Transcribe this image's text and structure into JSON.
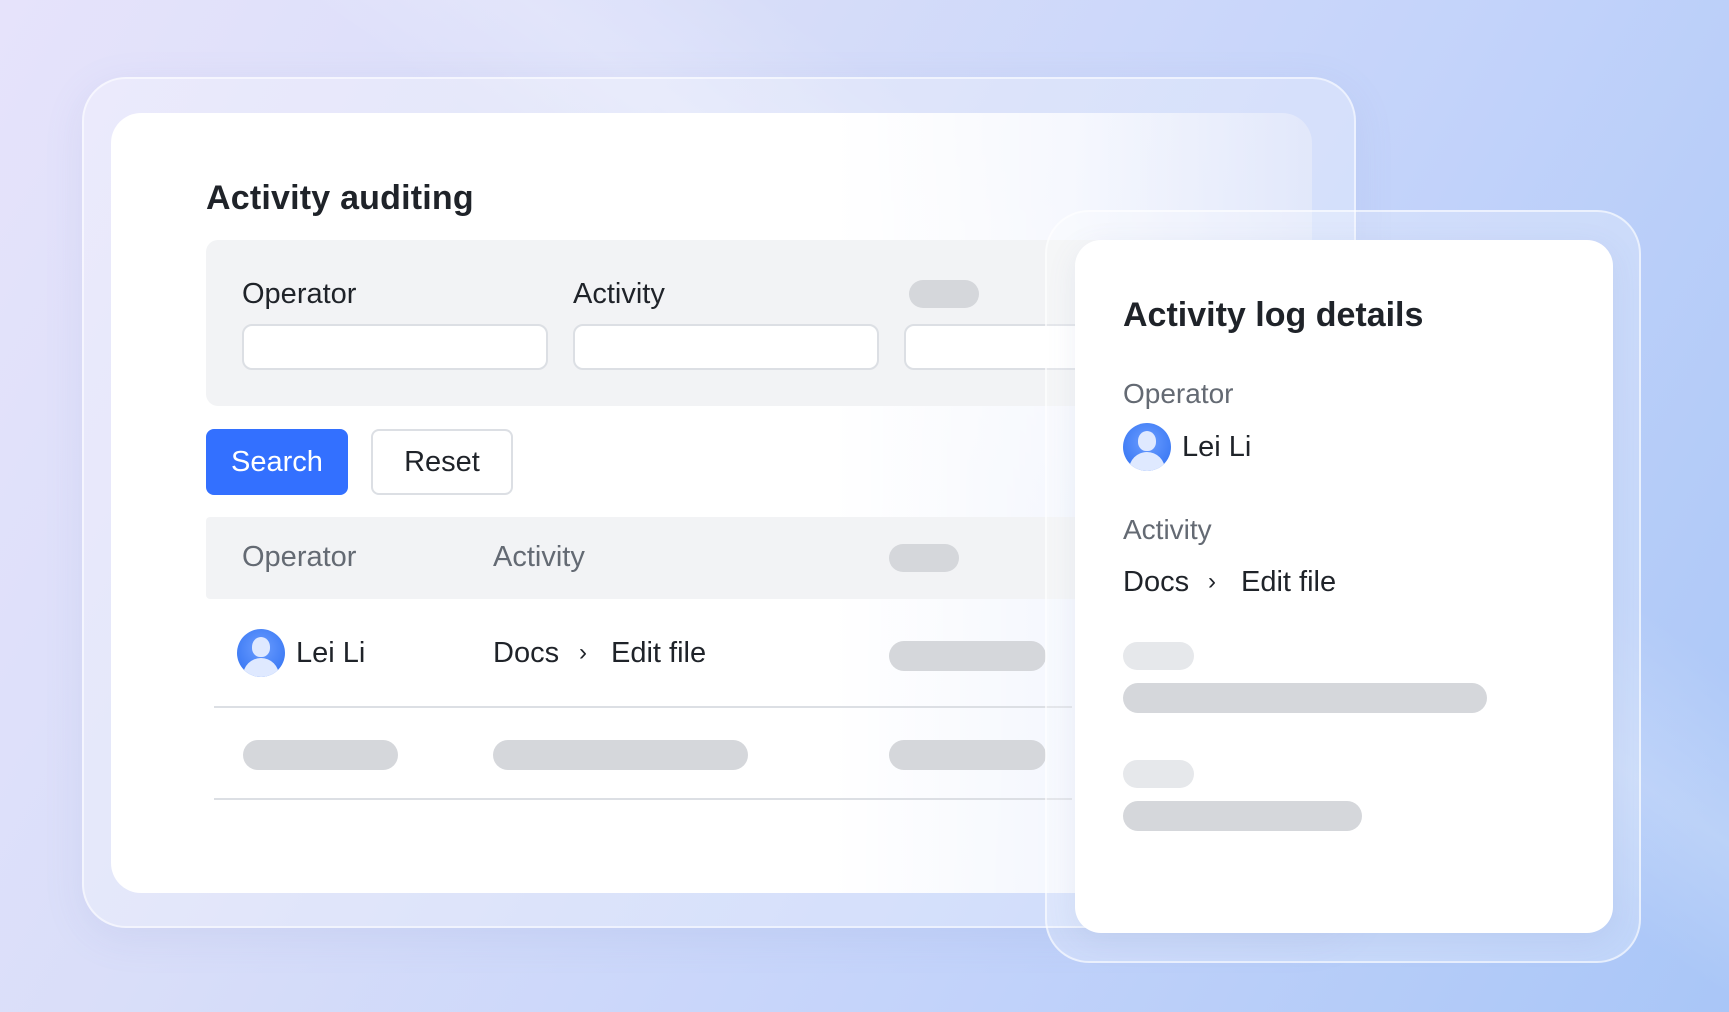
{
  "audit": {
    "title": "Activity auditing",
    "filters": {
      "operator_label": "Operator",
      "operator_value": "",
      "activity_label": "Activity",
      "activity_value": ""
    },
    "buttons": {
      "search": "Search",
      "reset": "Reset"
    },
    "table": {
      "headers": [
        "Operator",
        "Activity"
      ],
      "rows": [
        {
          "operator": "Lei Li",
          "activity_app": "Docs",
          "activity_action": "Edit file",
          "avatar_icon": "user-avatar-icon"
        }
      ]
    }
  },
  "details": {
    "title": "Activity log details",
    "operator_label": "Operator",
    "operator_name": "Lei Li",
    "activity_label": "Activity",
    "activity_app": "Docs",
    "activity_action": "Edit file"
  },
  "colors": {
    "accent": "#3370ff",
    "panel_bg": "#f2f3f5",
    "skeleton": "#d5d7db",
    "muted_text": "#646a73"
  },
  "icons": {
    "breadcrumb_separator": "chevron-right-icon",
    "avatar": "user-avatar-icon"
  }
}
